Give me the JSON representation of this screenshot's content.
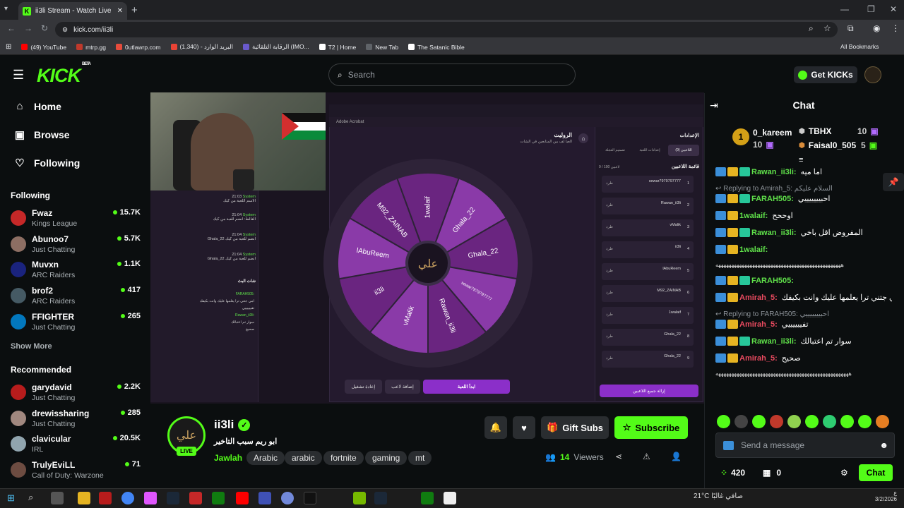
{
  "browser": {
    "tab_title": "ii3li Stream - Watch Live on Kick",
    "url": "kick.com/ii3li",
    "bookmarks": [
      {
        "label": "(49) YouTube",
        "color": "#ff0000"
      },
      {
        "label": "mtrp.gg",
        "color": "#c0392b"
      },
      {
        "label": "0utlawrp.com",
        "color": "#e74c3c"
      },
      {
        "label": "البريد الوارد - (1,340)",
        "color": "#ea4335"
      },
      {
        "label": "الرقابة التلقائية (IMO...",
        "color": "#6a5acd"
      },
      {
        "label": "T2 | Home",
        "color": "#ffffff"
      },
      {
        "label": "New Tab",
        "color": "#5f6368"
      },
      {
        "label": "The Satanic Bible",
        "color": "#ffffff"
      }
    ],
    "all_bookmarks": "All Bookmarks"
  },
  "header": {
    "logo": "KICK",
    "logo_beta": "BETA",
    "search_placeholder": "Search",
    "get_kicks": "Get KICKs"
  },
  "sidebar": {
    "nav": [
      {
        "label": "Home",
        "icon": "home-icon"
      },
      {
        "label": "Browse",
        "icon": "browse-icon"
      },
      {
        "label": "Following",
        "icon": "heart-icon"
      }
    ],
    "following_title": "Following",
    "following": [
      {
        "name": "Fwaz",
        "game": "Kings League",
        "viewers": "15.7K",
        "color": "#c62828"
      },
      {
        "name": "Abunoo7",
        "game": "Just Chatting",
        "viewers": "5.7K",
        "color": "#8d6e63"
      },
      {
        "name": "Muvxn",
        "game": "ARC Raiders",
        "viewers": "1.1K",
        "color": "#1a237e"
      },
      {
        "name": "brof2",
        "game": "ARC Raiders",
        "viewers": "417",
        "color": "#455a64"
      },
      {
        "name": "FFIGHTER",
        "game": "Just Chatting",
        "viewers": "265",
        "color": "#0277bd"
      }
    ],
    "show_more": "Show More",
    "recommended_title": "Recommended",
    "recommended": [
      {
        "name": "garydavid",
        "game": "Just Chatting",
        "viewers": "2.2K",
        "color": "#b71c1c"
      },
      {
        "name": "drewissharing",
        "game": "Just Chatting",
        "viewers": "285",
        "color": "#a1887f"
      },
      {
        "name": "clavicular",
        "game": "IRL",
        "viewers": "20.5K",
        "color": "#90a4ae"
      },
      {
        "name": "TrulyEviLL",
        "game": "Call of Duty: Warzone",
        "viewers": "71",
        "color": "#6d4c41"
      }
    ]
  },
  "player": {
    "wheel_title": "الروليت",
    "wheel_subtitle": "العبا لف بين المتابعين في الشات",
    "wheel_segments": [
      "1walaif",
      "Ghala_22",
      "Ghala_22",
      "sewar7979797777",
      "Rawan_ii3li",
      "vMalik",
      "ii3li",
      "lAbuReem",
      "M92_ZAINAB"
    ],
    "wheel_center": "علي",
    "btn_start": "ابدأ اللعبة",
    "btn_add": "إضافة لاعب",
    "btn_replay": "إعادة تشغيل",
    "panel_title": "الإعدادات",
    "panel_tabs": [
      "اللاعبين (9)",
      "إعدادات اللعبة",
      "تصميم العجلة"
    ],
    "player_list_title": "قائمة اللاعبين",
    "player_list_count": "9 / 100 لاعبين",
    "players": [
      "sewar7979797777",
      "Rawan_ii3li",
      "vMalik",
      "ii3li",
      "lAbuReem",
      "M92_ZAINAB",
      "1walaif",
      "Ghala_22",
      "Ghala_22"
    ],
    "kick_label": "طرد",
    "remove_all": "إزالة جميع اللاعبين",
    "old_chat_title": "شات البث",
    "old_chat": [
      {
        "time": "21:03",
        "user": "System",
        "text": "الاسم اللعبة من كيك"
      },
      {
        "time": "21:04",
        "user": "System",
        "text": "الغالط: انضم للعبة من كيك"
      },
      {
        "time": "21:04",
        "user": "System",
        "text": "Ghala_22 انضم للعبة من كيك"
      },
      {
        "time": "21:04",
        "user": "System",
        "text": "Ghala_22 انضم للعبة من كيك"
      }
    ],
    "app_tab": "Adobe Acrobat"
  },
  "stream": {
    "name": "ii3li",
    "title": "ابو ريم سبب التاخير",
    "category": "Jawlah",
    "tags": [
      "Arabic",
      "arabic",
      "fortnite",
      "gaming",
      "mt"
    ],
    "live": "LIVE",
    "viewers": "14",
    "viewers_label": "Viewers",
    "gift_subs": "Gift Subs",
    "subscribe": "Subscribe",
    "avatar_text": "علي"
  },
  "chat": {
    "title": "Chat",
    "leaderboard": [
      {
        "rank": "1",
        "name": "0_kareem",
        "count": "10"
      },
      {
        "rank": "2",
        "name": "TBHX",
        "count": "10"
      },
      {
        "rank": "3",
        "name": "Faisal0_505",
        "count": "5"
      }
    ],
    "messages": [
      {
        "type": "msg",
        "user": "Rawan_ii3li:",
        "color": "g",
        "text": "اما ميه"
      },
      {
        "type": "reply",
        "text": "Replying to Amirah_5: السلام عليكم"
      },
      {
        "type": "msg",
        "user": "FARAH505:",
        "color": "g",
        "text": "احبيييييييي"
      },
      {
        "type": "msg",
        "user": "1walaif:",
        "color": "g",
        "text": "اوححح"
      },
      {
        "type": "msg",
        "user": "Rawan_ii3li:",
        "color": "g",
        "text": "المفروض اقل باخي"
      },
      {
        "type": "msg",
        "user": "1walaif:",
        "color": "g",
        "text": ""
      },
      {
        "type": "spam",
        "text": "ههههههههههههههههههههههههههههههههههههههههههههههههه"
      },
      {
        "type": "msg",
        "user": "FARAH505:",
        "color": "g",
        "text": ""
      },
      {
        "type": "msg",
        "user": "Amirah_5:",
        "color": "r",
        "text": "امي جتني ترا يعلمها عليك وانت بكيفك"
      },
      {
        "type": "reply",
        "text": "Replying to FARAH505: احبيييييييي"
      },
      {
        "type": "msg",
        "user": "Amirah_5:",
        "color": "r",
        "text": "تفييييييي"
      },
      {
        "type": "msg",
        "user": "Rawan_ii3li:",
        "color": "g",
        "text": "سوار تم اعتبالك"
      },
      {
        "type": "msg",
        "user": "Amirah_5:",
        "color": "r",
        "text": "صحيح"
      },
      {
        "type": "spam",
        "text": "هههههههههههههههههههههههههههههههههههههههههههههههههههه"
      }
    ],
    "input_placeholder": "Send a message",
    "points": "420",
    "gifts": "0",
    "chat_button": "Chat"
  },
  "taskbar": {
    "weather": "21°C صافي غالبًا",
    "time": "ع",
    "date": "3/2/2026"
  }
}
